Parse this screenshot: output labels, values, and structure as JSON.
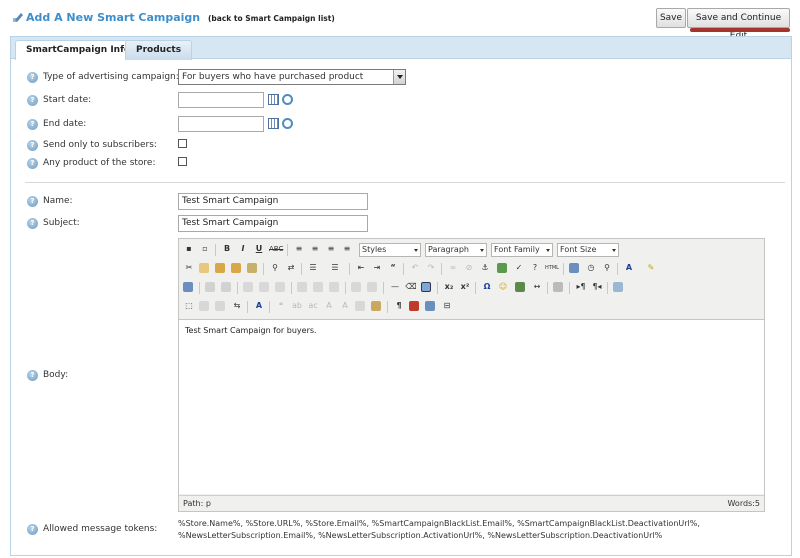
{
  "header": {
    "title": "Add A New Smart Campaign",
    "back_link": "(back to Smart Campaign list)",
    "save_label": "Save",
    "save_continue_label": "Save and Continue Edit"
  },
  "tabs": [
    {
      "label": "SmartCampaign Info",
      "active": true
    },
    {
      "label": "Products",
      "active": false
    }
  ],
  "form": {
    "type_label": "Type of advertising campaign:",
    "type_value": "For buyers who have purchased product",
    "start_date_label": "Start date:",
    "end_date_label": "End date:",
    "subscribers_label": "Send only to subscribers:",
    "any_product_label": "Any product of the store:",
    "name_label": "Name:",
    "name_value": "Test Smart Campaign",
    "subject_label": "Subject:",
    "subject_value": "Test Smart Campaign",
    "body_label": "Body:",
    "tokens_label": "Allowed message tokens:"
  },
  "editor": {
    "styles": "Styles",
    "paragraph": "Paragraph",
    "font_family": "Font Family",
    "font_size": "Font Size",
    "content": "Test Smart Campaign for buyers.",
    "path": "Path: p",
    "words": "Words:5"
  },
  "tokens": {
    "line1": "%Store.Name%, %Store.URL%, %Store.Email%, %SmartCampaignBlackList.Email%, %SmartCampaignBlackList.DeactivationUrl%,",
    "line2": "%NewsLetterSubscription.Email%, %NewsLetterSubscription.ActivationUrl%, %NewsLetterSubscription.DeactivationUrl%"
  }
}
